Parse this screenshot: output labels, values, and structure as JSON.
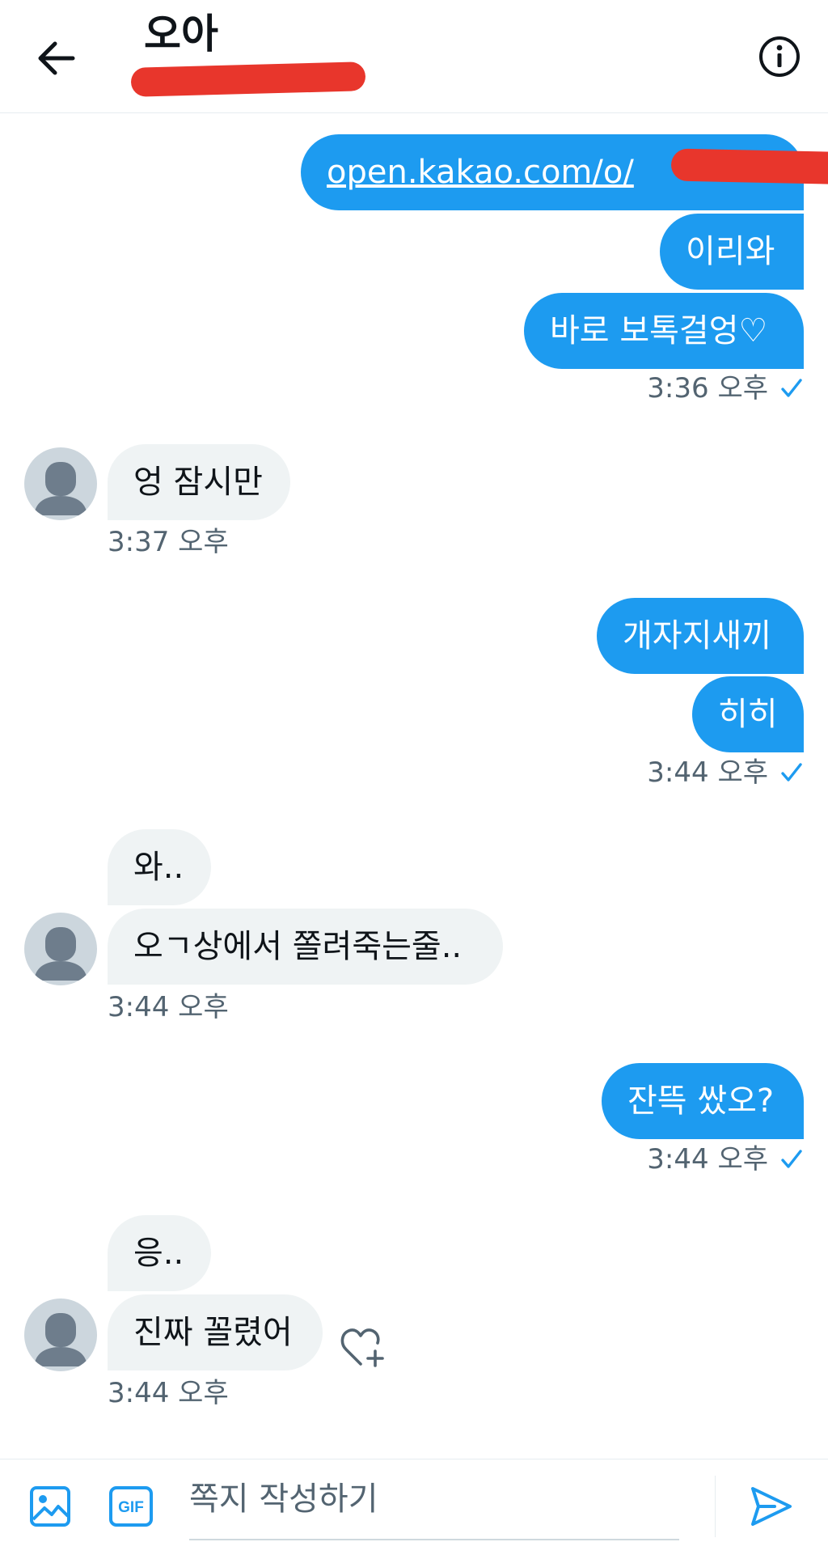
{
  "header": {
    "title": "오아",
    "handle": ""
  },
  "messages": {
    "out1": {
      "link": "open.kakao.com/o/",
      "m2": "이리와",
      "m3": "바로 보톡걸엉♡",
      "time": "3:36 오후"
    },
    "in1": {
      "m1": "엉 잠시만",
      "time": "3:37 오후"
    },
    "out2": {
      "m1": "개자지새끼",
      "m2": "히히",
      "time": "3:44 오후"
    },
    "in2": {
      "m1": "와..",
      "m2": "오ㄱ상에서 쫄려죽는줄..",
      "time": "3:44 오후"
    },
    "out3": {
      "m1": "잔뜩 쌌오?",
      "time": "3:44 오후"
    },
    "in3": {
      "m1": "응..",
      "m2": "진짜 꼴렸어",
      "time": "3:44 오후"
    }
  },
  "composer": {
    "placeholder": "쪽지 작성하기",
    "gif_label": "GIF"
  },
  "colors": {
    "accent": "#1d9bf0",
    "incoming_bubble": "#eff3f4",
    "muted_text": "#536471",
    "redaction": "#e8362c"
  },
  "icons": [
    "back-arrow-icon",
    "info-icon",
    "check-icon",
    "default-avatar-icon",
    "heart-plus-icon",
    "image-icon",
    "gif-icon",
    "send-icon"
  ]
}
